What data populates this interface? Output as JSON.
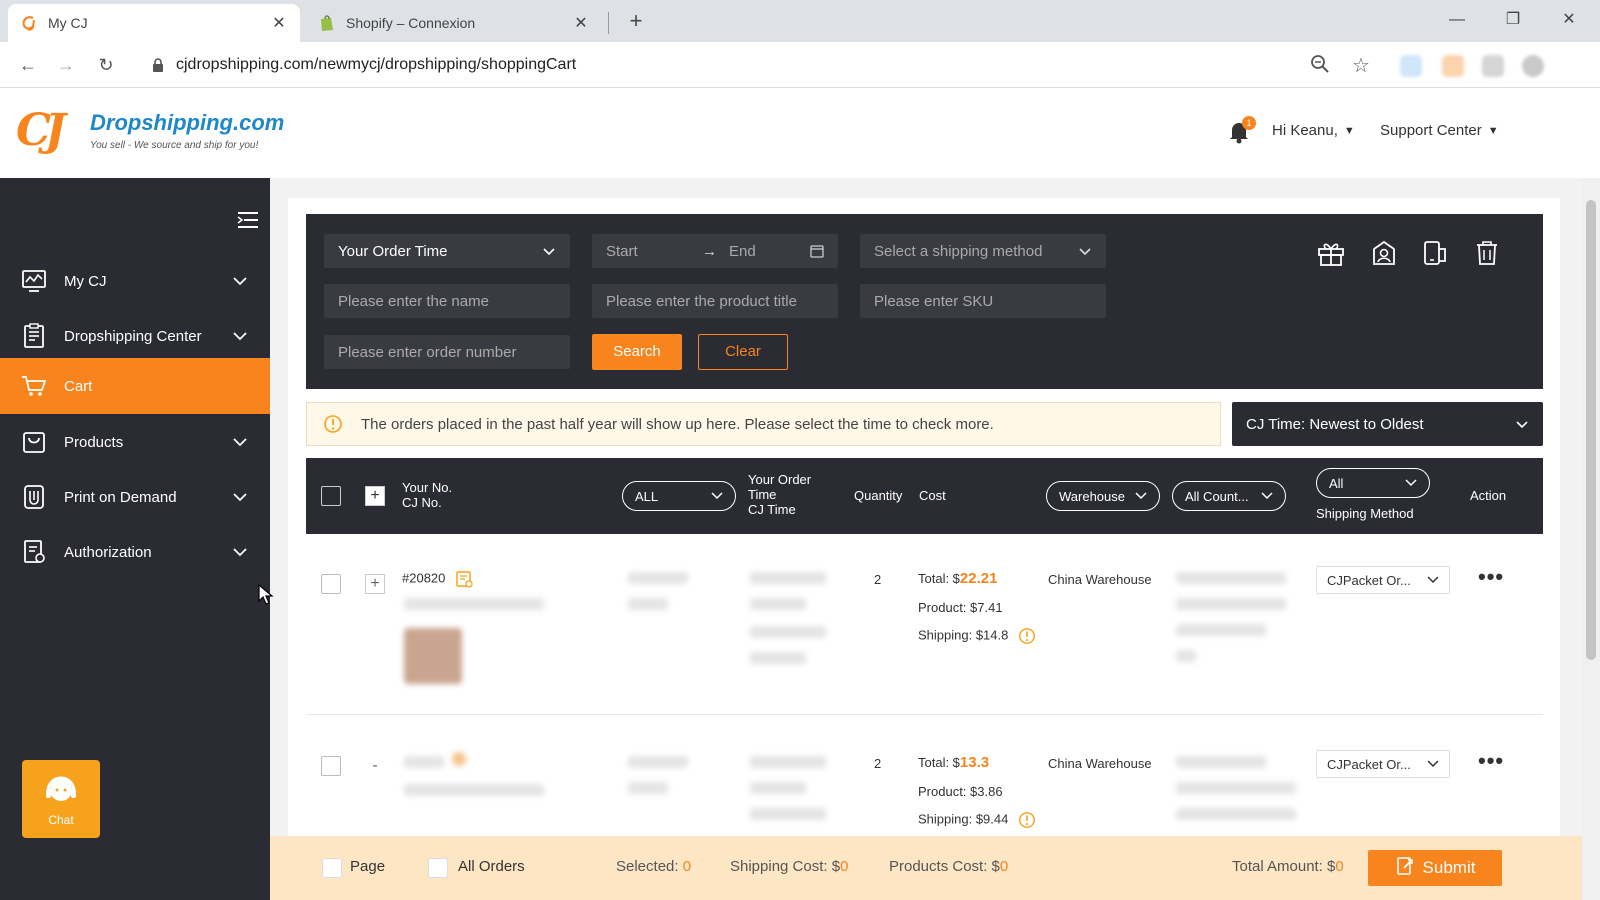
{
  "browser": {
    "tabs": [
      {
        "title": "My CJ",
        "active": true
      },
      {
        "title": "Shopify – Connexion",
        "active": false
      }
    ],
    "url": "cjdropshipping.com/newmycj/dropshipping/shoppingCart"
  },
  "header": {
    "logo_name": "Dropshipping.com",
    "logo_mark": "CJ",
    "logo_tagline": "You sell - We source and ship for you!",
    "notification_count": "1",
    "user_menu": "Hi Keanu,",
    "support_menu": "Support Center"
  },
  "sidebar": {
    "items": [
      {
        "label": "My CJ",
        "icon": "monitor-chart-icon",
        "active": false,
        "expandable": true
      },
      {
        "label": "Dropshipping Center",
        "icon": "list-doc-icon",
        "active": false,
        "expandable": true
      },
      {
        "label": "Cart",
        "icon": "cart-icon",
        "active": true,
        "expandable": false
      },
      {
        "label": "Products",
        "icon": "bag-icon",
        "active": false,
        "expandable": true
      },
      {
        "label": "Print on Demand",
        "icon": "pod-icon",
        "active": false,
        "expandable": true
      },
      {
        "label": "Authorization",
        "icon": "auth-doc-icon",
        "active": false,
        "expandable": true
      }
    ],
    "chat_label": "Chat"
  },
  "filters": {
    "order_time": "Your Order Time",
    "start_placeholder": "Start",
    "end_placeholder": "End",
    "shipping_method_placeholder": "Select a shipping method",
    "name_placeholder": "Please enter the name",
    "product_title_placeholder": "Please enter the product title",
    "sku_placeholder": "Please enter SKU",
    "order_number_placeholder": "Please enter order number",
    "search_label": "Search",
    "clear_label": "Clear"
  },
  "notice": {
    "text": "The orders placed in the past half year will show up here. Please select the time to check more.",
    "sort": "CJ Time: Newest to Oldest"
  },
  "table": {
    "headers": {
      "your_no": "Your No.",
      "cj_no": "CJ No.",
      "store_filter": "ALL",
      "order_time_1": "Your Order",
      "order_time_2": "Time",
      "cj_time": "CJ Time",
      "quantity": "Quantity",
      "cost": "Cost",
      "warehouse_filter": "Warehouse",
      "country_filter": "All Count...",
      "shipping_filter": "All",
      "shipping_method": "Shipping Method",
      "action": "Action"
    },
    "rows": [
      {
        "order_no": "#20820",
        "expand": "+",
        "quantity": "2",
        "total_label": "Total: $",
        "total_value": "22.21",
        "product_cost": "Product: $7.41",
        "shipping_cost": "Shipping: $14.8",
        "warehouse": "China Warehouse",
        "shipping_method": "CJPacket Or...",
        "action": "•••"
      },
      {
        "order_no": "",
        "expand": "-",
        "quantity": "2",
        "total_label": "Total: $",
        "total_value": "13.3",
        "product_cost": "Product: $3.86",
        "shipping_cost": "Shipping: $9.44",
        "warehouse": "China Warehouse",
        "shipping_method": "CJPacket Or...",
        "action": "•••"
      }
    ]
  },
  "footer": {
    "page_label": "Page",
    "all_orders_label": "All Orders",
    "selected_label": "Selected:",
    "selected_value": "0",
    "shipping_cost_label": "Shipping Cost: $",
    "shipping_cost_value": "0",
    "products_cost_label": "Products Cost: $",
    "products_cost_value": "0",
    "total_amount_label": "Total Amount: $",
    "total_amount_value": "0",
    "submit_label": "Submit"
  },
  "colors": {
    "accent": "#f7841c",
    "dark_panel": "#2b2c33",
    "brand_blue": "#1e88c8"
  }
}
